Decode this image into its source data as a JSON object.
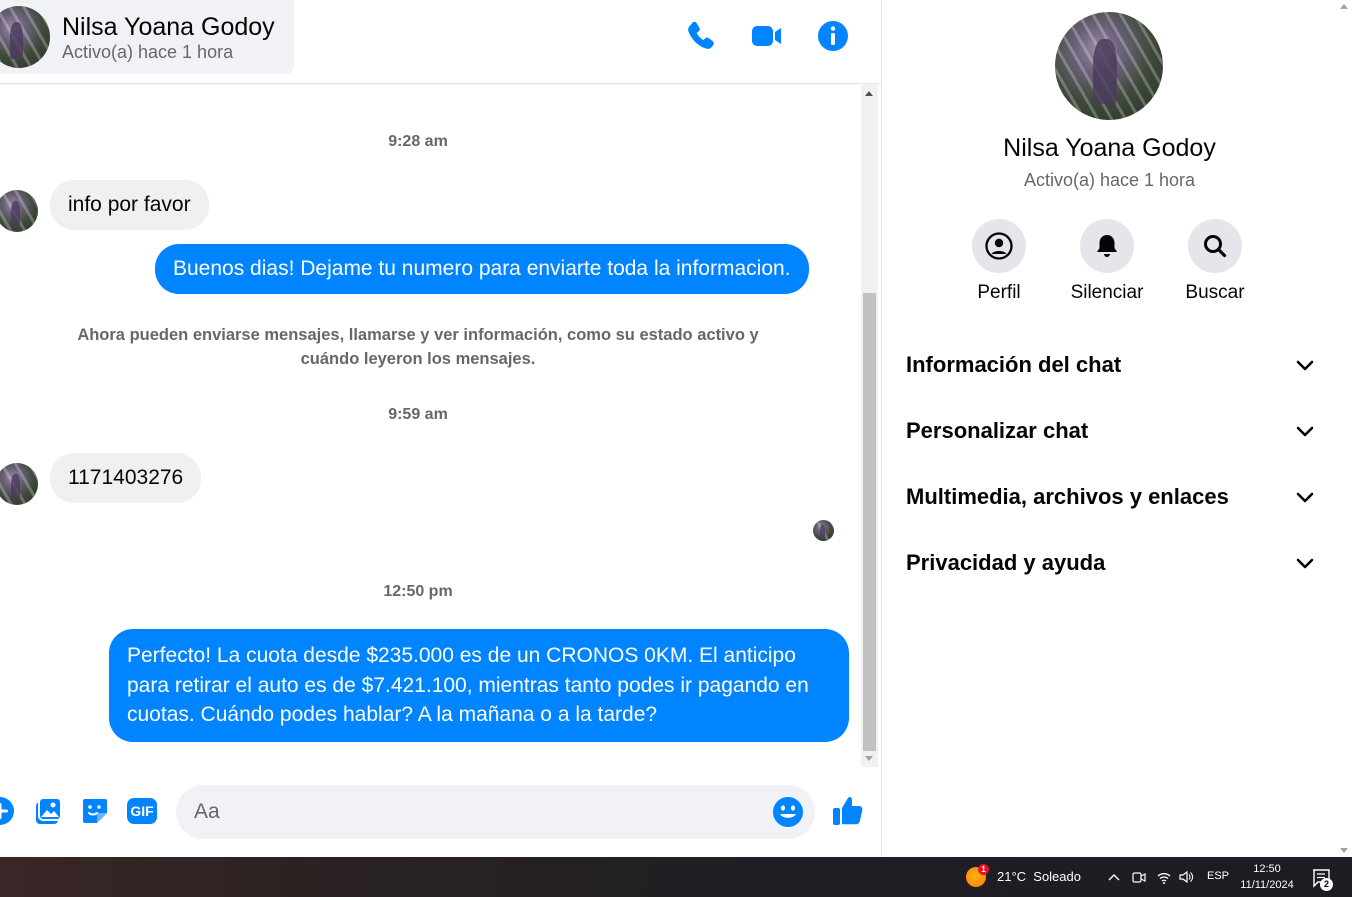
{
  "colors": {
    "accent": "#0084ff",
    "incoming_bubble": "#f0f0f0",
    "secondary_text": "#65676b",
    "action_circle": "#e4e6eb"
  },
  "header": {
    "contact_name": "Nilsa Yoana Godoy",
    "status": "Activo(a) hace 1 hora",
    "icons": [
      "phone-icon",
      "video-camera-icon",
      "info-icon"
    ]
  },
  "messages": {
    "timestamp_1": "9:28 am",
    "incoming_1": "info por favor",
    "outgoing_1": "Buenos dias! Dejame tu numero para enviarte toda la informacion.",
    "system_note": "Ahora pueden enviarse mensajes, llamarse y ver información, como su estado activo y cuándo leyeron los mensajes.",
    "timestamp_2": "9:59 am",
    "incoming_2": "1171403276",
    "timestamp_3": "12:50 pm",
    "outgoing_2": "Perfecto! La cuota desde $235.000 es de un CRONOS 0KM. El anticipo para retirar el auto es de $7.421.100, mientras tanto podes ir pagando en cuotas. Cuándo podes hablar? A la mañana o a la tarde?"
  },
  "composer": {
    "placeholder": "Aa",
    "icons": [
      "plus-icon",
      "photo-icon",
      "sticker-icon",
      "gif-icon",
      "emoji-icon",
      "thumbs-up-icon"
    ],
    "gif_label": "GIF"
  },
  "panel": {
    "name": "Nilsa Yoana Godoy",
    "status": "Activo(a) hace 1 hora",
    "actions": [
      {
        "label": "Perfil",
        "icon": "profile-icon"
      },
      {
        "label": "Silenciar",
        "icon": "bell-icon"
      },
      {
        "label": "Buscar",
        "icon": "search-icon"
      }
    ],
    "sections": [
      {
        "label": "Información del chat"
      },
      {
        "label": "Personalizar chat"
      },
      {
        "label": "Multimedia, archivos y enlaces"
      },
      {
        "label": "Privacidad y ayuda"
      }
    ]
  },
  "taskbar": {
    "weather": "21°C  Soleado",
    "weather_badge": "1",
    "language": "ESP",
    "time": "12:50",
    "date": "11/11/2024",
    "notification_count": "2"
  }
}
